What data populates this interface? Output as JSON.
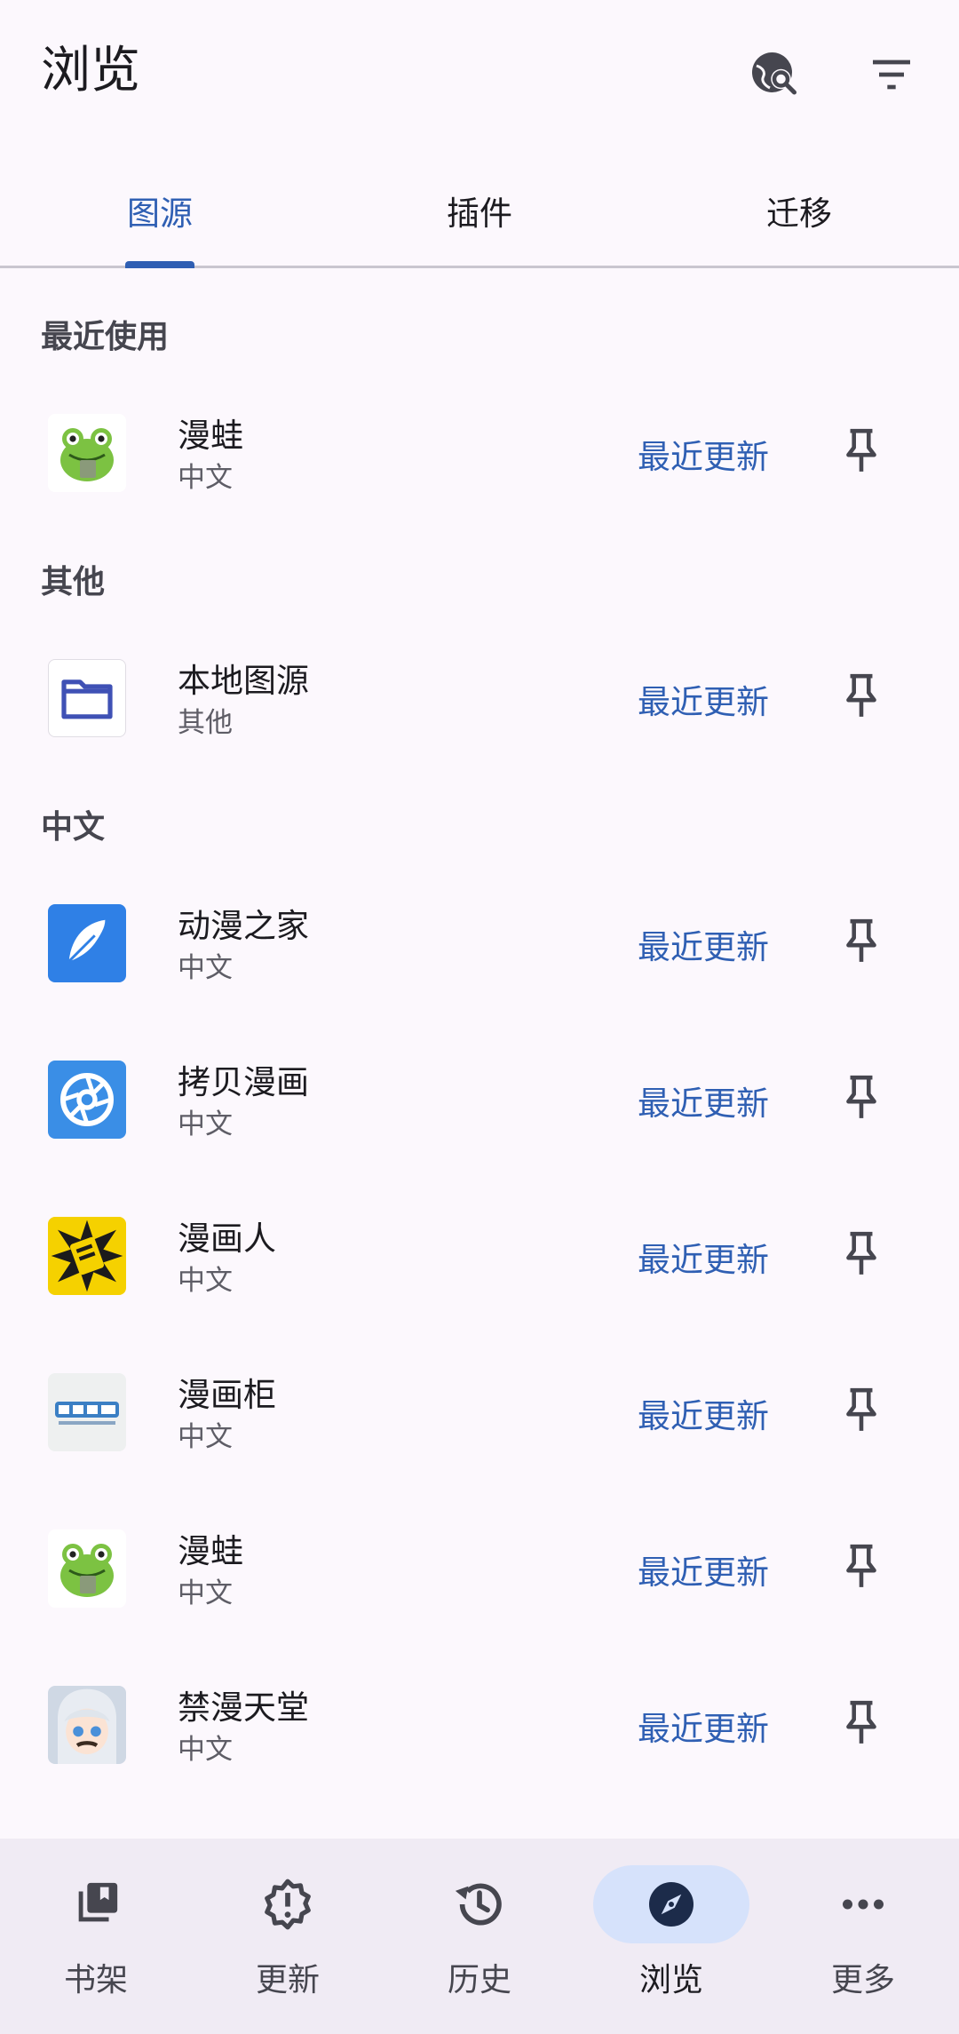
{
  "header": {
    "title": "浏览"
  },
  "tabs": [
    {
      "label": "图源",
      "active": true
    },
    {
      "label": "插件",
      "active": false
    },
    {
      "label": "迁移",
      "active": false
    }
  ],
  "sections": [
    {
      "title": "最近使用"
    },
    {
      "title": "其他"
    },
    {
      "title": "中文"
    }
  ],
  "sources": [
    {
      "name": "漫蛙",
      "lang": "中文",
      "latest": "最近更新",
      "icon": "frog-logo"
    },
    {
      "name": "本地图源",
      "lang": "其他",
      "latest": "最近更新",
      "icon": "folder-icon"
    },
    {
      "name": "动漫之家",
      "lang": "中文",
      "latest": "最近更新",
      "icon": "feather-logo"
    },
    {
      "name": "拷贝漫画",
      "lang": "中文",
      "latest": "最近更新",
      "icon": "aperture-logo"
    },
    {
      "name": "漫画人",
      "lang": "中文",
      "latest": "最近更新",
      "icon": "comic-burst-logo"
    },
    {
      "name": "漫画柜",
      "lang": "中文",
      "latest": "最近更新",
      "icon": "manhuagui-logo"
    },
    {
      "name": "漫蛙",
      "lang": "中文",
      "latest": "最近更新",
      "icon": "frog-logo"
    },
    {
      "name": "禁漫天堂",
      "lang": "中文",
      "latest": "最近更新",
      "icon": "anime-girl-logo"
    }
  ],
  "nav": [
    {
      "label": "书架",
      "icon": "library-icon",
      "active": false
    },
    {
      "label": "更新",
      "icon": "alert-badge-icon",
      "active": false
    },
    {
      "label": "历史",
      "icon": "history-icon",
      "active": false
    },
    {
      "label": "浏览",
      "icon": "compass-icon",
      "active": true
    },
    {
      "label": "更多",
      "icon": "more-horiz-icon",
      "active": false
    }
  ],
  "colors": {
    "accent": "#2f5fb3",
    "background": "#fcf8fd",
    "navbar": "#f0ebf4",
    "active_pill": "#d6e2fb"
  }
}
